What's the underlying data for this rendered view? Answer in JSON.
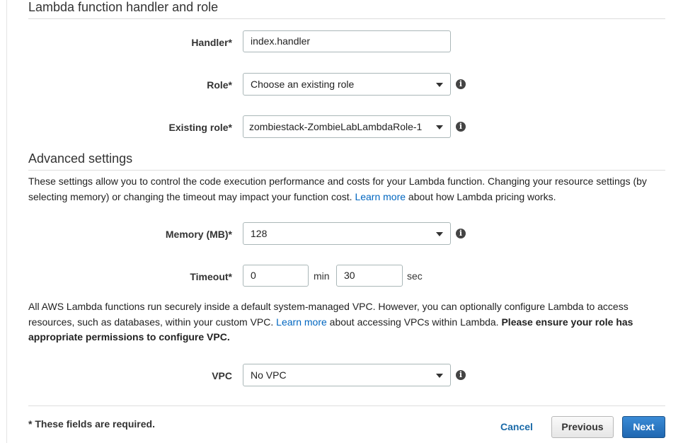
{
  "handler_section": {
    "title": "Lambda function handler and role",
    "handler": {
      "label": "Handler*",
      "value": "index.handler"
    },
    "role": {
      "label": "Role*",
      "value": "Choose an existing role"
    },
    "existing_role": {
      "label": "Existing role*",
      "value": "zombiestack-ZombieLabLambdaRole-1"
    }
  },
  "advanced_section": {
    "title": "Advanced settings",
    "description": {
      "text_before_link": "These settings allow you to control the code execution performance and costs for your Lambda function. Changing your resource settings (by selecting memory) or changing the timeout may impact your function cost. ",
      "link": "Learn more",
      "text_after_link": " about how Lambda pricing works."
    },
    "memory": {
      "label": "Memory (MB)*",
      "value": "128"
    },
    "timeout": {
      "label": "Timeout*",
      "min_value": "0",
      "min_unit": "min",
      "sec_value": "30",
      "sec_unit": "sec"
    },
    "vpc_note": {
      "text_before_link": "All AWS Lambda functions run securely inside a default system-managed VPC. However, you can optionally configure Lambda to access resources, such as databases, within your custom VPC. ",
      "link": "Learn more",
      "text_after_link": " about accessing VPCs within Lambda. ",
      "bold_text": "Please ensure your role has appropriate permissions to configure VPC."
    },
    "vpc": {
      "label": "VPC",
      "value": "No VPC"
    }
  },
  "info_icon_glyph": "i",
  "footer": {
    "required_note": "* These fields are required.",
    "cancel_label": "Cancel",
    "previous_label": "Previous",
    "next_label": "Next"
  },
  "colors": {
    "link": "#0066c0",
    "primary_button": "#1f67b1",
    "border": "#aab7b8"
  }
}
